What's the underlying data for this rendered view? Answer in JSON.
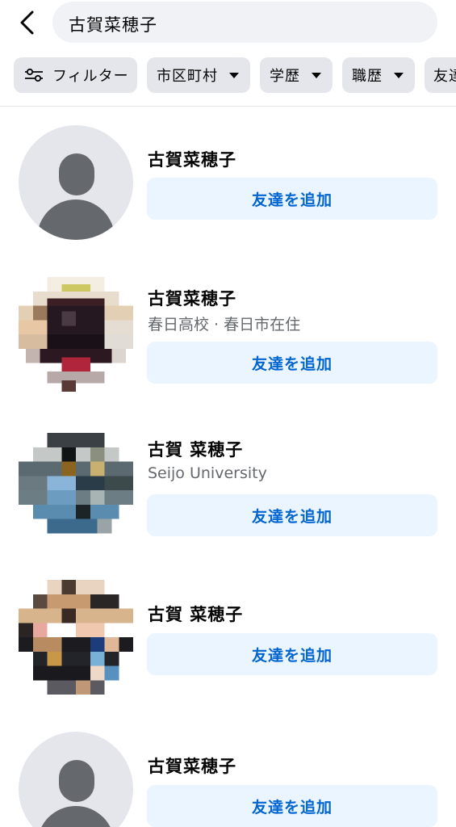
{
  "search": {
    "query": "古賀菜穂子"
  },
  "filters": [
    {
      "label": "フィルター",
      "icon": "sliders-icon"
    },
    {
      "label": "市区町村",
      "icon": "caret-down-icon"
    },
    {
      "label": "学歴",
      "icon": "caret-down-icon"
    },
    {
      "label": "職歴",
      "icon": "caret-down-icon"
    },
    {
      "label": "友達"
    }
  ],
  "results": [
    {
      "name": "古賀菜穂子",
      "subtitle": "",
      "avatar": "default-avatar",
      "action": "友達を追加"
    },
    {
      "name": "古賀菜穂子",
      "subtitle": "春日高校 · 春日市在住",
      "avatar": "pixelated-photo",
      "action": "友達を追加"
    },
    {
      "name": "古賀 菜穂子",
      "subtitle": "Seijo University",
      "avatar": "pixelated-photo",
      "action": "友達を追加"
    },
    {
      "name": "古賀 菜穂子",
      "subtitle": "",
      "avatar": "pixelated-photo",
      "action": "友達を追加"
    },
    {
      "name": "古賀菜穂子",
      "subtitle": "",
      "avatar": "default-avatar",
      "action": "友達を追加"
    }
  ],
  "colors": {
    "accent": "#0064d1",
    "button_bg": "#ebf5ff",
    "chip_bg": "#e4e6eb",
    "search_bg": "#f0f2f5",
    "secondary_text": "#65686c"
  }
}
